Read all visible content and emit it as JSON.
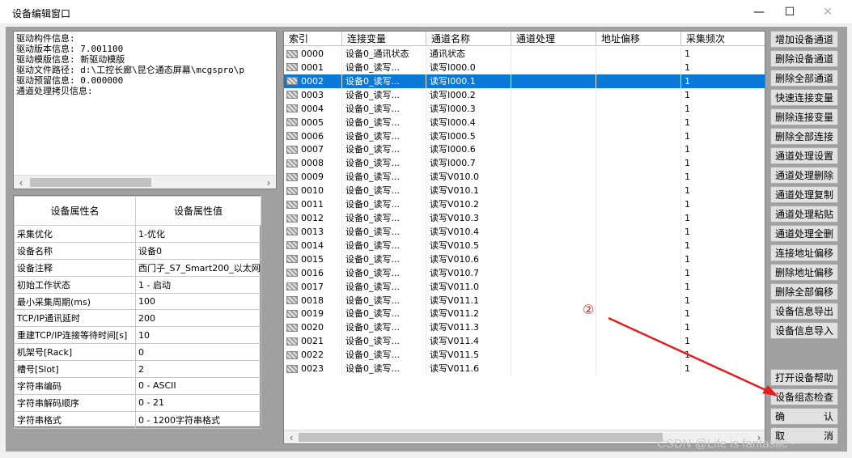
{
  "window": {
    "title": "设备编辑窗口",
    "min": "—",
    "max": "☐",
    "close": "✕"
  },
  "info_lines": [
    "驱动构件信息:",
    "驱动版本信息: 7.001100",
    "驱动模版信息: 新驱动模版",
    "驱动文件路径: d:\\工控长廊\\昆仑通态屏幕\\mcgspro\\p",
    "驱动预留信息: 0.000000",
    "通道处理拷贝信息:"
  ],
  "props": {
    "header_name": "设备属性名",
    "header_value": "设备属性值",
    "rows": [
      [
        "采集优化",
        "1-优化"
      ],
      [
        "设备名称",
        "设备0"
      ],
      [
        "设备注释",
        "西门子_S7_Smart200_以太网"
      ],
      [
        "初始工作状态",
        "1 - 启动"
      ],
      [
        "最小采集周期(ms)",
        "100"
      ],
      [
        "TCP/IP通讯延时",
        "200"
      ],
      [
        "重建TCP/IP连接等待时间[s]",
        "10"
      ],
      [
        "机架号[Rack]",
        "0"
      ],
      [
        "槽号[Slot]",
        "2"
      ],
      [
        "字符串编码",
        "0 - ASCII"
      ],
      [
        "字符串解码顺序",
        "0 - 21"
      ],
      [
        "字符串格式",
        "0 - 1200字符串格式"
      ]
    ]
  },
  "grid": {
    "columns": [
      "索引",
      "连接变量",
      "通道名称",
      "通道处理",
      "地址偏移",
      "采集频次"
    ],
    "selected_index": 2,
    "rows": [
      [
        "0000",
        "设备0_通讯状态",
        "通讯状态",
        "",
        "",
        "1"
      ],
      [
        "0001",
        "设备0_读写...",
        "读写I000.0",
        "",
        "",
        "1"
      ],
      [
        "0002",
        "设备0_读写...",
        "读写I000.1",
        "",
        "",
        "1"
      ],
      [
        "0003",
        "设备0_读写...",
        "读写I000.2",
        "",
        "",
        "1"
      ],
      [
        "0004",
        "设备0_读写...",
        "读写I000.3",
        "",
        "",
        "1"
      ],
      [
        "0005",
        "设备0_读写...",
        "读写I000.4",
        "",
        "",
        "1"
      ],
      [
        "0006",
        "设备0_读写...",
        "读写I000.5",
        "",
        "",
        "1"
      ],
      [
        "0007",
        "设备0_读写...",
        "读写I000.6",
        "",
        "",
        "1"
      ],
      [
        "0008",
        "设备0_读写...",
        "读写I000.7",
        "",
        "",
        "1"
      ],
      [
        "0009",
        "设备0_读写...",
        "读写V010.0",
        "",
        "",
        "1"
      ],
      [
        "0010",
        "设备0_读写...",
        "读写V010.1",
        "",
        "",
        "1"
      ],
      [
        "0011",
        "设备0_读写...",
        "读写V010.2",
        "",
        "",
        "1"
      ],
      [
        "0012",
        "设备0_读写...",
        "读写V010.3",
        "",
        "",
        "1"
      ],
      [
        "0013",
        "设备0_读写...",
        "读写V010.4",
        "",
        "",
        "1"
      ],
      [
        "0014",
        "设备0_读写...",
        "读写V010.5",
        "",
        "",
        "1"
      ],
      [
        "0015",
        "设备0_读写...",
        "读写V010.6",
        "",
        "",
        "1"
      ],
      [
        "0016",
        "设备0_读写...",
        "读写V010.7",
        "",
        "",
        "1"
      ],
      [
        "0017",
        "设备0_读写...",
        "读写V011.0",
        "",
        "",
        "1"
      ],
      [
        "0018",
        "设备0_读写...",
        "读写V011.1",
        "",
        "",
        "1"
      ],
      [
        "0019",
        "设备0_读写...",
        "读写V011.2",
        "",
        "",
        "1"
      ],
      [
        "0020",
        "设备0_读写...",
        "读写V011.3",
        "",
        "",
        "1"
      ],
      [
        "0021",
        "设备0_读写...",
        "读写V011.4",
        "",
        "",
        "1"
      ],
      [
        "0022",
        "设备0_读写...",
        "读写V011.5",
        "",
        "",
        "1"
      ],
      [
        "0023",
        "设备0_读写...",
        "读写V011.6",
        "",
        "",
        "1"
      ]
    ]
  },
  "buttons": [
    {
      "label": "增加设备通道"
    },
    {
      "label": "删除设备通道"
    },
    {
      "label": "删除全部通道"
    },
    {
      "label": "快速连接变量"
    },
    {
      "label": "删除连接变量"
    },
    {
      "label": "删除全部连接"
    },
    {
      "label": "通道处理设置"
    },
    {
      "label": "通道处理删除"
    },
    {
      "label": "通道处理复制"
    },
    {
      "label": "通道处理粘贴"
    },
    {
      "label": "通道处理全删"
    },
    {
      "label": "连接地址偏移"
    },
    {
      "label": "删除地址偏移"
    },
    {
      "label": "删除全部偏移"
    },
    {
      "label": "设备信息导出"
    },
    {
      "label": "设备信息导入"
    }
  ],
  "bottom_buttons": {
    "help": "打开设备帮助",
    "check": "设备组态检查",
    "ok_a": "确",
    "ok_b": "认",
    "cancel_a": "取",
    "cancel_b": "消"
  },
  "annotation": "②",
  "watermark": "CSDN @Life is fantastic~",
  "colors": {
    "selection": "#0a78d7",
    "annotation": "#e02020"
  }
}
